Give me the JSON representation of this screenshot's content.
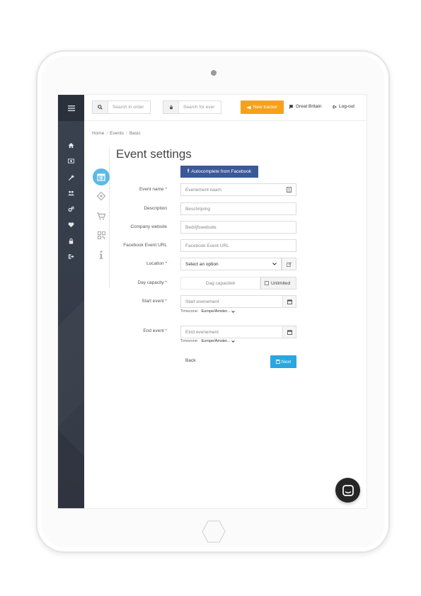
{
  "header": {
    "search_orders_placeholder": "Search in orders",
    "search_events_placeholder": "Search for events",
    "new_tracker_label": "New tracker",
    "country_label": "Great Britain",
    "logout_label": "Log-out"
  },
  "breadcrumb": [
    "Home",
    "Events",
    "Basic"
  ],
  "page": {
    "title": "Event settings",
    "facebook_button": "Autocomplete from Facebook"
  },
  "form": {
    "event_name": {
      "label": "Event name",
      "placeholder": "Evenement naam"
    },
    "description": {
      "label": "Description",
      "placeholder": "Beschrijving"
    },
    "company_website": {
      "label": "Company website",
      "placeholder": "Bedrijfswebsite"
    },
    "facebook_event_url": {
      "label": "Facebook Event URL",
      "placeholder": "Facebook Event URL"
    },
    "location": {
      "label": "Location",
      "value": "Select an option"
    },
    "day_capacity": {
      "label": "Day capacity",
      "placeholder": "Dag capaciteit",
      "unlimited_label": "Unlimited"
    },
    "start_event": {
      "label": "Start event",
      "placeholder": "Start evenement",
      "timezone_label": "Timezone:",
      "timezone_value": "Europe/Amster..."
    },
    "end_event": {
      "label": "End event",
      "placeholder": "Eind evenement",
      "timezone_label": "Timezone:",
      "timezone_value": "Europe/Amster..."
    },
    "required_marker": "*"
  },
  "actions": {
    "back_label": "Back",
    "next_label": "Next"
  },
  "colors": {
    "sidebar_bg": "#353c48",
    "new_tracker": "#f7a11a",
    "facebook": "#3b5998",
    "next": "#2aa7e0",
    "step_active": "#5bb9e6",
    "required": "#e03b3b"
  },
  "icons": {
    "sidebar": [
      "menu-icon",
      "home-icon",
      "money-icon",
      "wrench-icon",
      "users-icon",
      "cogs-icon",
      "heart-icon",
      "lock-icon",
      "sign-out-icon"
    ],
    "steps": [
      "calendar-icon",
      "ticket-icon",
      "cart-icon",
      "qrcode-icon",
      "info-icon"
    ]
  }
}
